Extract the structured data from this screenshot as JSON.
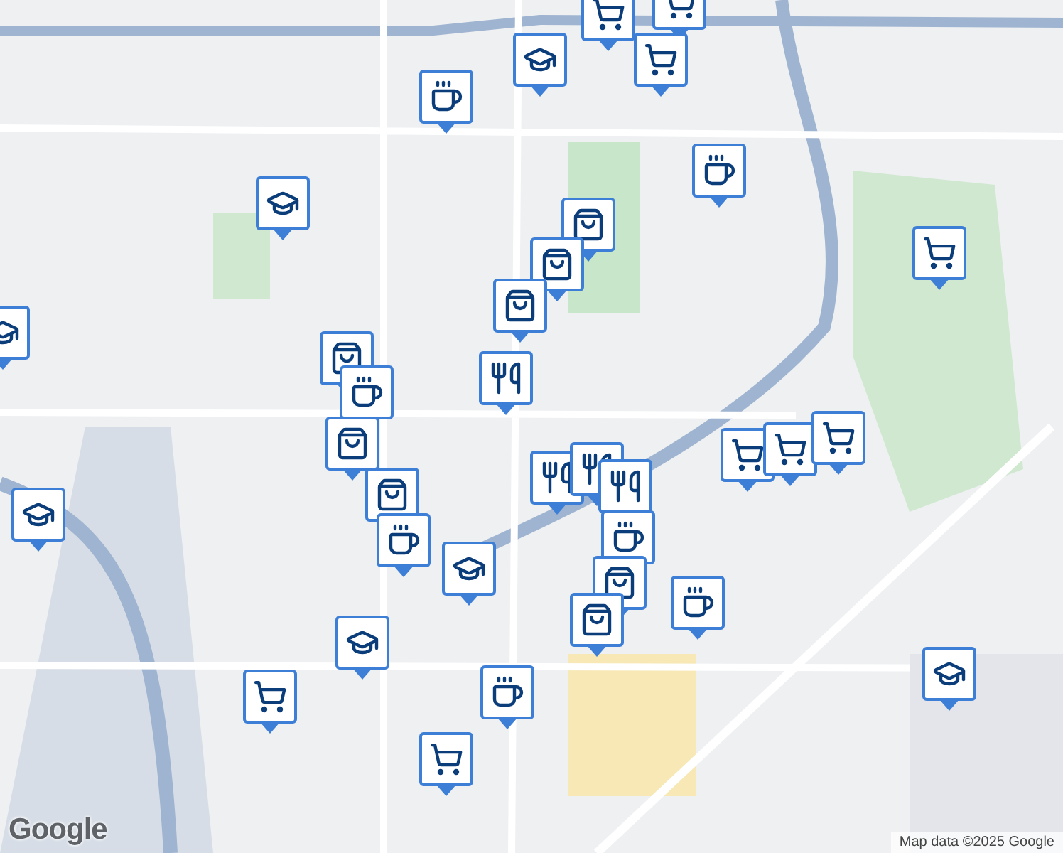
{
  "markers": [
    {
      "kind": "cart"
    },
    {
      "kind": "cart"
    },
    {
      "kind": "cap"
    },
    {
      "kind": "cart"
    },
    {
      "kind": "coffee"
    },
    {
      "kind": "coffee"
    },
    {
      "kind": "cap"
    },
    {
      "kind": "bag"
    },
    {
      "kind": "bag"
    },
    {
      "kind": "cart"
    },
    {
      "kind": "bag"
    },
    {
      "kind": "cap"
    },
    {
      "kind": "bag"
    },
    {
      "kind": "coffee"
    },
    {
      "kind": "fork"
    },
    {
      "kind": "bag"
    },
    {
      "kind": "cart"
    },
    {
      "kind": "cart"
    },
    {
      "kind": "cart"
    },
    {
      "kind": "fork"
    },
    {
      "kind": "fork"
    },
    {
      "kind": "fork"
    },
    {
      "kind": "cap"
    },
    {
      "kind": "bag"
    },
    {
      "kind": "coffee"
    },
    {
      "kind": "coffee"
    },
    {
      "kind": "cap"
    },
    {
      "kind": "bag"
    },
    {
      "kind": "bag"
    },
    {
      "kind": "coffee"
    },
    {
      "kind": "cap"
    },
    {
      "kind": "cap"
    },
    {
      "kind": "cart"
    },
    {
      "kind": "coffee"
    },
    {
      "kind": "cart"
    }
  ],
  "logo": "Google",
  "attribution": "Map data ©2025 Google"
}
